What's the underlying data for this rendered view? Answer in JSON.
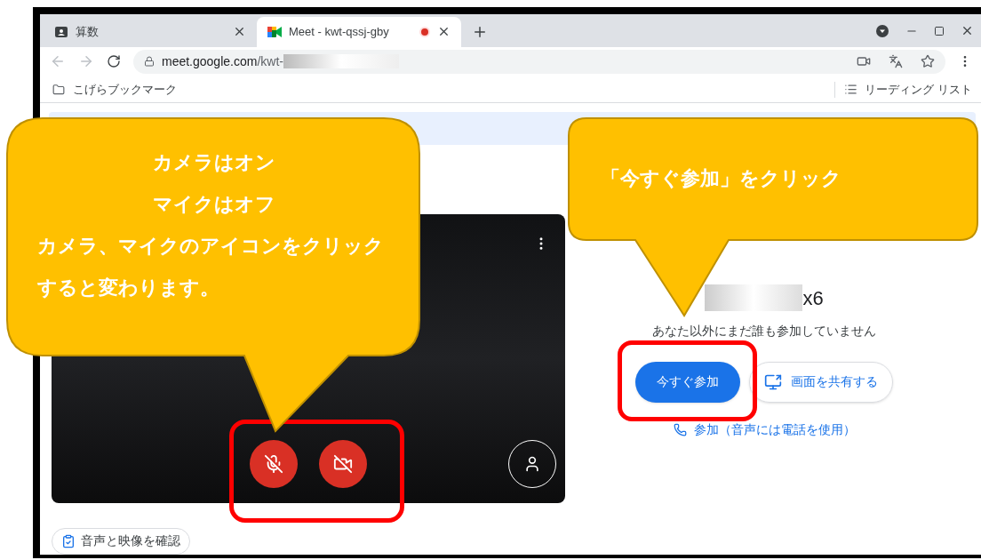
{
  "browser": {
    "tabs": [
      {
        "title": "算数",
        "selected": false,
        "recording": false
      },
      {
        "title": "Meet - kwt-qssj-gby",
        "selected": true,
        "recording": true
      }
    ],
    "url": {
      "host": "meet.google.com",
      "path": "/kwt-"
    },
    "bookmark_folder": "こげらブックマーク",
    "reading_list": "リーディング リスト"
  },
  "meet": {
    "meeting_name_tail": "x6",
    "status": "あなた以外にまだ誰も参加していません",
    "join_button": "今すぐ参加",
    "share_button": "画面を共有する",
    "phone_join": "参加（音声には電話を使用）",
    "check_button": "音声と映像を確認",
    "mic": {
      "on": false
    },
    "camera": {
      "on": false
    }
  },
  "callouts": [
    {
      "title_lines": [
        "カメラはオン",
        "マイクはオフ"
      ],
      "body_lines": [
        "カメラ、マイクのアイコンをクリック",
        "すると変わります。"
      ]
    },
    {
      "body_lines": [
        "「今すぐ参加」をクリック"
      ]
    }
  ]
}
